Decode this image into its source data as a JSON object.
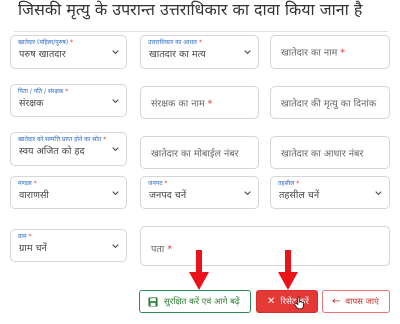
{
  "heading": "जिसकी मृत्यु के उपरान्त उत्तराधिकार का दावा किया जाना है",
  "fields": {
    "khatedar": {
      "label": "खातेदार (महिला/पुरुष)",
      "value": "परुष खातदार"
    },
    "adhar": {
      "label": "उत्तराधिकार का आधार",
      "value": "खातदार का मत्य"
    },
    "khatedar_name": {
      "placeholder": "खातेदार का नाम"
    },
    "pita": {
      "label": "पिता / पति / संरक्षक",
      "value": "संरक्षक"
    },
    "sanrakshak_name": {
      "placeholder": "संरक्षक का नाम"
    },
    "death_date": {
      "placeholder": "खातेदार की मृत्यु का दिनांक"
    },
    "sampatti": {
      "label": "खातेदार को सम्पत्ति प्राप्त होने का स्रोत",
      "value": "स्वय अजित को हद"
    },
    "mobile": {
      "placeholder": "खातेदार का मोबाईल नंबर"
    },
    "aadhar_no": {
      "placeholder": "खातेदार का आधार नंबर"
    },
    "mandal": {
      "label": "मण्डल",
      "value": "वाराणसी"
    },
    "janpad": {
      "label": "जनपद",
      "value": "जनपद चनें"
    },
    "tehsil": {
      "label": "तहसील",
      "value": "तहसील चनें"
    },
    "gram": {
      "label": "ग्राम",
      "value": "ग्राम चनें"
    },
    "pata": {
      "placeholder": "पता"
    }
  },
  "buttons": {
    "save": "सुरक्षित करें एवं आगे बढ़ें",
    "reset": "रिसेट करें",
    "back": "वापस जाएं"
  },
  "colors": {
    "accent_label": "#2b68c8",
    "required": "#e53935",
    "reset_bg": "#e53935",
    "save_text": "#2e7d32",
    "arrow": "#e8141a"
  },
  "icons": {
    "save": "floppy-disk-icon",
    "reset": "x-icon",
    "back": "arrow-left-icon",
    "select": "chevron-down-icon",
    "cursor": "hand-pointer-icon"
  }
}
